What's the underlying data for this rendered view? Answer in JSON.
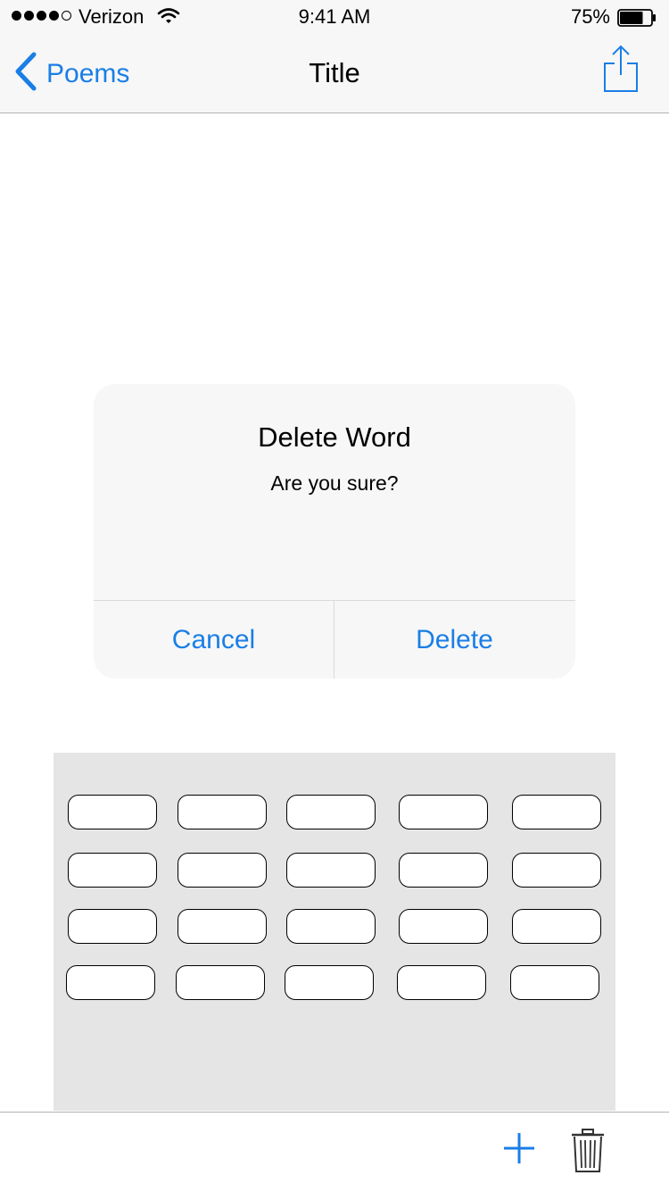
{
  "status_bar": {
    "carrier": "Verizon",
    "time": "9:41 AM",
    "battery_percent": "75%",
    "battery_level": 0.75,
    "signal_bars_filled": 4,
    "signal_bars_total": 5
  },
  "nav": {
    "back_label": "Poems",
    "title": "Title"
  },
  "alert": {
    "title": "Delete Word",
    "message": "Are you sure?",
    "cancel_label": "Cancel",
    "delete_label": "Delete"
  },
  "colors": {
    "accent": "#1a7ee6",
    "bar_background": "#f7f7f7",
    "panel_background": "#e5e5e5"
  },
  "icons": {
    "back": "chevron-left-icon",
    "share": "share-icon",
    "add": "plus-icon",
    "trash": "trash-icon",
    "wifi": "wifi-icon",
    "battery": "battery-icon"
  }
}
